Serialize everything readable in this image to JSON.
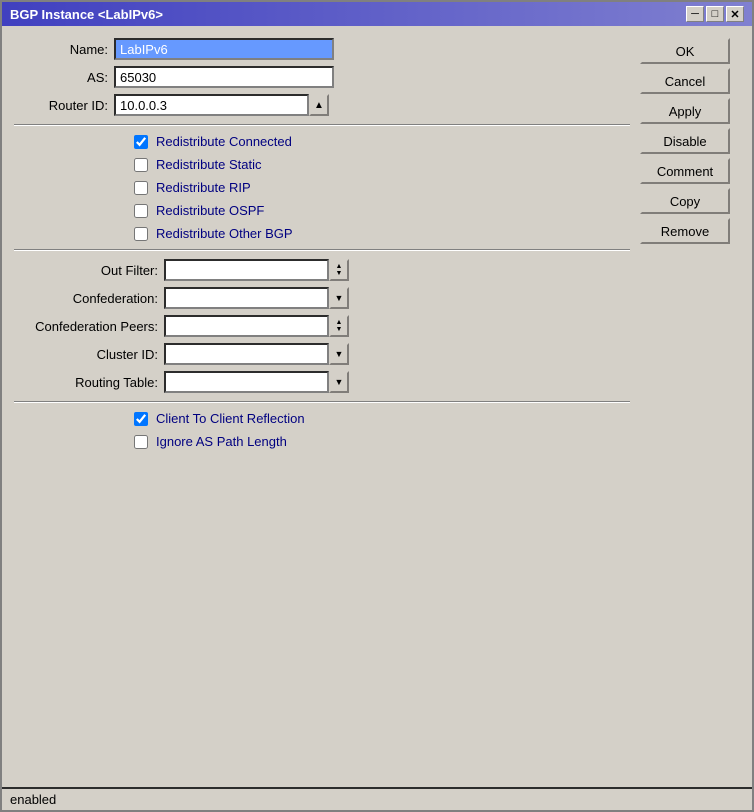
{
  "window": {
    "title": "BGP Instance <LabIPv6>"
  },
  "title_buttons": {
    "minimize": "─",
    "maximize": "□",
    "close": "✕"
  },
  "form": {
    "name_label": "Name:",
    "name_value": "LabIPv6",
    "as_label": "AS:",
    "as_value": "65030",
    "router_id_label": "Router ID:",
    "router_id_value": "10.0.0.3"
  },
  "checkboxes": {
    "redistribute_connected": {
      "label": "Redistribute Connected",
      "checked": true
    },
    "redistribute_static": {
      "label": "Redistribute Static",
      "checked": false
    },
    "redistribute_rip": {
      "label": "Redistribute RIP",
      "checked": false
    },
    "redistribute_ospf": {
      "label": "Redistribute OSPF",
      "checked": false
    },
    "redistribute_other_bgp": {
      "label": "Redistribute Other BGP",
      "checked": false
    },
    "client_to_client": {
      "label": "Client To Client Reflection",
      "checked": true
    },
    "ignore_as_path": {
      "label": "Ignore AS Path Length",
      "checked": false
    }
  },
  "filters": {
    "out_filter_label": "Out Filter:",
    "out_filter_value": "",
    "confederation_label": "Confederation:",
    "confederation_value": "",
    "confederation_peers_label": "Confederation Peers:",
    "confederation_peers_value": "",
    "cluster_id_label": "Cluster ID:",
    "cluster_id_value": "",
    "routing_table_label": "Routing Table:",
    "routing_table_value": ""
  },
  "buttons": {
    "ok": "OK",
    "cancel": "Cancel",
    "apply": "Apply",
    "disable": "Disable",
    "comment": "Comment",
    "copy": "Copy",
    "remove": "Remove"
  },
  "status": {
    "text": "enabled"
  }
}
